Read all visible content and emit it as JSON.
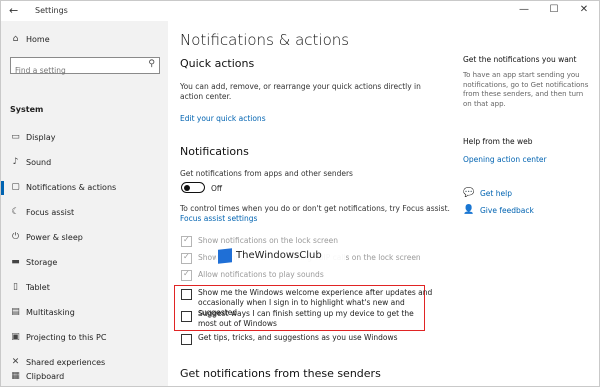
{
  "window": {
    "title": "Settings",
    "controls": {
      "minimize": "—",
      "maximize": "☐",
      "close": "✕"
    }
  },
  "sidebar": {
    "home": "Home",
    "search_placeholder": "Find a setting",
    "section": "System",
    "items": [
      {
        "label": "Display",
        "icon": "display-icon"
      },
      {
        "label": "Sound",
        "icon": "sound-icon"
      },
      {
        "label": "Notifications & actions",
        "icon": "notifications-icon",
        "active": true
      },
      {
        "label": "Focus assist",
        "icon": "focus-assist-icon"
      },
      {
        "label": "Power & sleep",
        "icon": "power-icon"
      },
      {
        "label": "Storage",
        "icon": "storage-icon"
      },
      {
        "label": "Tablet",
        "icon": "tablet-icon"
      },
      {
        "label": "Multitasking",
        "icon": "multitasking-icon"
      },
      {
        "label": "Projecting to this PC",
        "icon": "projecting-icon"
      },
      {
        "label": "Shared experiences",
        "icon": "shared-experiences-icon"
      },
      {
        "label": "Clipboard",
        "icon": "clipboard-icon"
      }
    ]
  },
  "main": {
    "title": "Notifications & actions",
    "quick_actions": {
      "heading": "Quick actions",
      "description": "You can add, remove, or rearrange your quick actions directly in action center.",
      "link": "Edit your quick actions"
    },
    "notifications": {
      "heading": "Notifications",
      "from_apps_label": "Get notifications from apps and other senders",
      "toggle_state": "Off",
      "focus_text": "To control times when you do or don't get notifications, try Focus assist.",
      "focus_link": "Focus assist settings",
      "options": [
        {
          "label": "Show notifications on the lock screen",
          "checked": true,
          "disabled": true
        },
        {
          "label": "Show reminders and incoming VoIP calls on the lock screen",
          "checked": true,
          "disabled": true
        },
        {
          "label": "Allow notifications to play sounds",
          "checked": true,
          "disabled": true
        },
        {
          "label": "Show me the Windows welcome experience after updates and occasionally when I sign in to highlight what's new and suggested",
          "checked": false,
          "disabled": false
        },
        {
          "label": "Suggest ways I can finish setting up my device to get the most out of Windows",
          "checked": false,
          "disabled": false
        },
        {
          "label": "Get tips, tricks, and suggestions as you use Windows",
          "checked": false,
          "disabled": false
        }
      ]
    },
    "senders_heading": "Get notifications from these senders"
  },
  "watermark": "TheWindowsClub",
  "right_panel": {
    "want_heading": "Get the notifications you want",
    "want_text": "To have an app start sending you notifications, go to Get notifications from these senders, and then turn on that app.",
    "web_heading": "Help from the web",
    "web_link": "Opening action center",
    "get_help": "Get help",
    "give_feedback": "Give feedback"
  },
  "colors": {
    "accent": "#0063b1",
    "highlight_box": "#e02424",
    "sidebar_bg": "#f2f2f2"
  }
}
